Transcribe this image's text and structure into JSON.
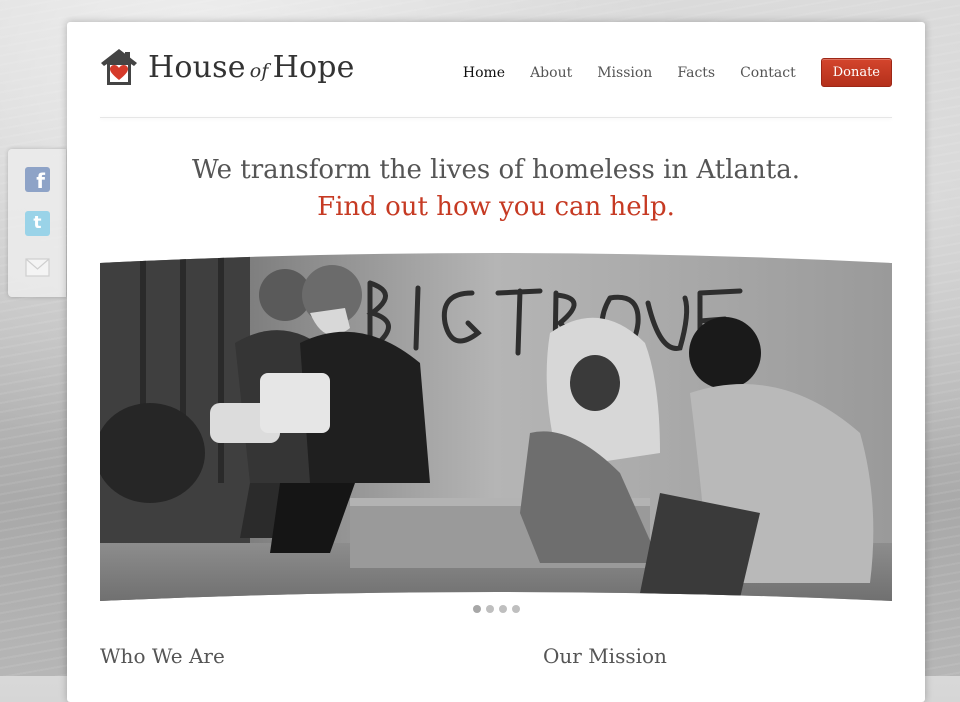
{
  "site": {
    "brand_part1": "House",
    "brand_part2": "of",
    "brand_part3": "Hope"
  },
  "nav": {
    "items": [
      {
        "label": "Home",
        "active": true
      },
      {
        "label": "About"
      },
      {
        "label": "Mission"
      },
      {
        "label": "Facts"
      },
      {
        "label": "Contact"
      }
    ],
    "donate_label": "Donate"
  },
  "hero": {
    "headline": "We transform the lives of homeless in Atlanta.",
    "cta": "Find out how you can help.",
    "image": "black-and-white photo of homeless men sitting against a graffiti wall",
    "slides_total": 4,
    "active_slide": 1
  },
  "sections": {
    "left_title": "Who We Are",
    "right_title": "Our Mission"
  },
  "social": [
    {
      "icon": "facebook-icon"
    },
    {
      "icon": "twitter-icon"
    },
    {
      "icon": "mail-icon"
    }
  ],
  "colors": {
    "accent": "#c63a23",
    "donate": "#c23a24",
    "text": "#555555"
  }
}
